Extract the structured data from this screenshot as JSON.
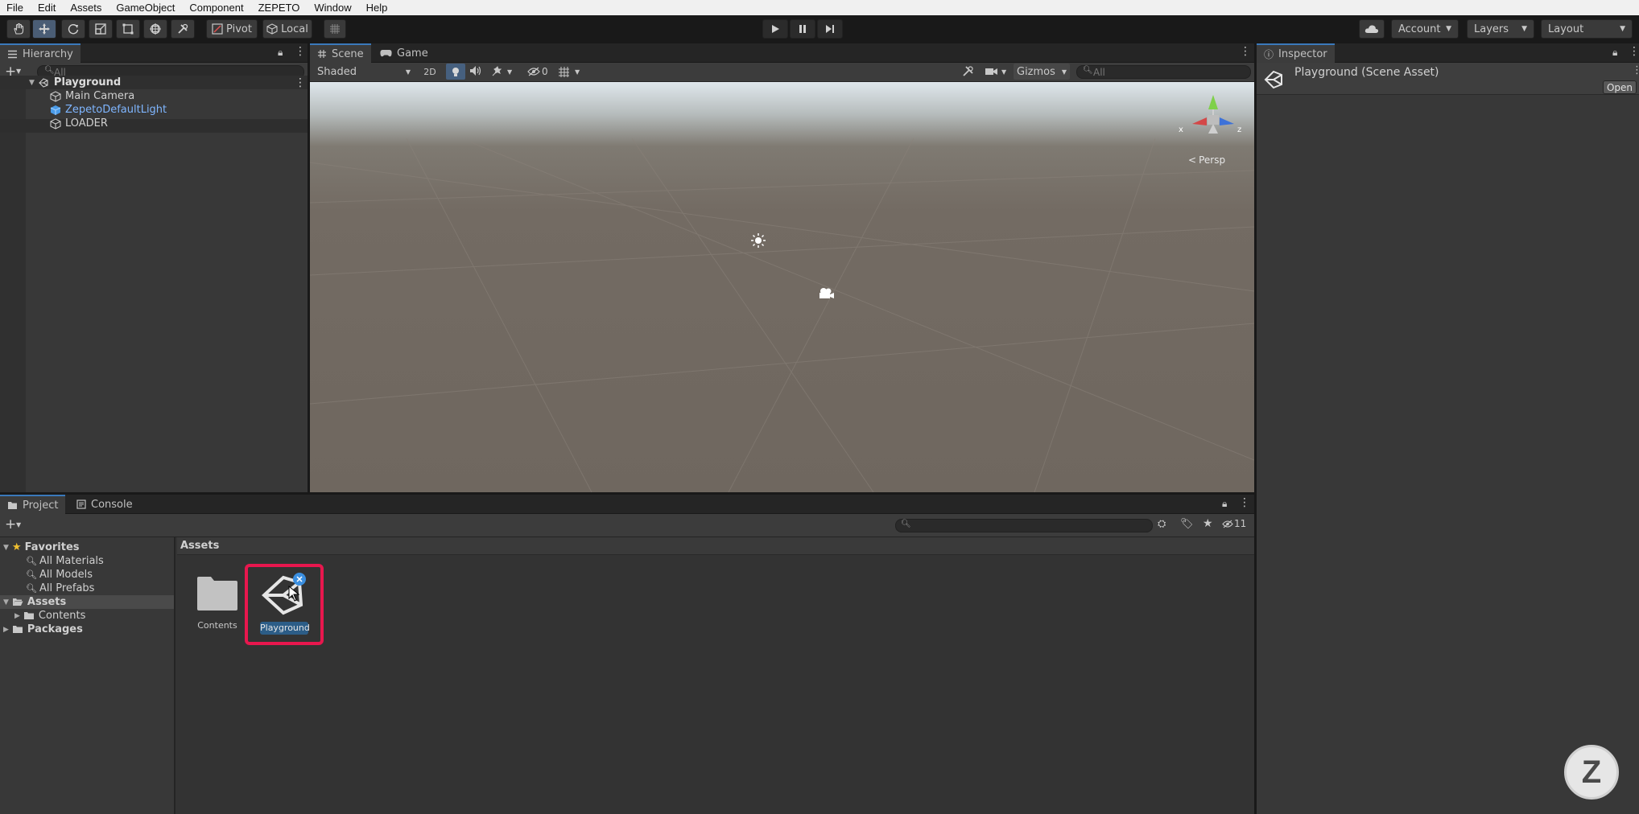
{
  "menubar": {
    "items": [
      "File",
      "Edit",
      "Assets",
      "GameObject",
      "Component",
      "ZEPETO",
      "Window",
      "Help"
    ]
  },
  "toolbar": {
    "pivot_label": "Pivot",
    "local_label": "Local",
    "account_label": "Account",
    "layers_label": "Layers",
    "layout_label": "Layout"
  },
  "hierarchy": {
    "tab_label": "Hierarchy",
    "search_placeholder": "All",
    "scene_name": "Playground",
    "objects": [
      {
        "label": "Main Camera",
        "color": "#c8c8c8"
      },
      {
        "label": "ZepetoDefaultLight",
        "color": "#7fb6ff"
      },
      {
        "label": "LOADER",
        "color": "#c8c8c8"
      }
    ]
  },
  "scene": {
    "tab_scene": "Scene",
    "tab_game": "Game",
    "shading_mode": "Shaded",
    "mode_2d": "2D",
    "hidden_count": "0",
    "gizmos_label": "Gizmos",
    "search_placeholder": "All",
    "persp_label": "Persp",
    "axis_x": "x",
    "axis_z": "z"
  },
  "inspector": {
    "tab_label": "Inspector",
    "title": "Playground (Scene Asset)",
    "open_button": "Open"
  },
  "project": {
    "tab_project": "Project",
    "tab_console": "Console",
    "hidden_count": "11",
    "favorites_label": "Favorites",
    "favorites": [
      "All Materials",
      "All Models",
      "All Prefabs"
    ],
    "assets_label": "Assets",
    "contents_label": "Contents",
    "packages_label": "Packages",
    "breadcrumb": "Assets",
    "items": [
      {
        "label": "Contents",
        "kind": "folder-icon"
      },
      {
        "label": "Playground",
        "kind": "unity-scene-icon",
        "selected": true
      }
    ],
    "highlight_color": "#e8174e"
  },
  "watermark": {
    "letter": "Z"
  }
}
